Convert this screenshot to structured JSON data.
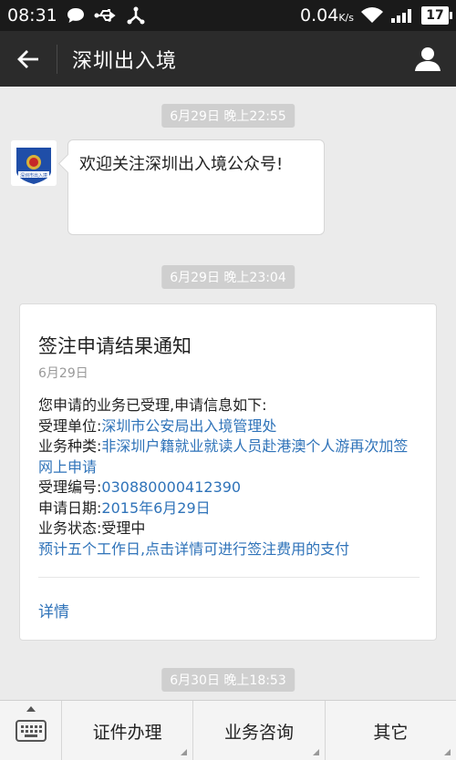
{
  "status_bar": {
    "time": "08:31",
    "net_speed": "0.04",
    "net_speed_unit": "K/s",
    "battery": "17"
  },
  "header": {
    "title": "深圳出入境"
  },
  "messages": [
    {
      "timestamp": "6月29日 晚上22:55",
      "text": "欢迎关注深圳出入境公众号!"
    },
    {
      "timestamp": "6月29日 晚上23:04"
    },
    {
      "timestamp": "6月30日 晚上18:53"
    }
  ],
  "card": {
    "title": "签注申请结果通知",
    "date": "6月29日",
    "intro": "您申请的业务已受理,申请信息如下:",
    "fields": [
      {
        "label": "受理单位:",
        "value": "深圳市公安局出入境管理处"
      },
      {
        "label": "业务种类:",
        "value": "非深圳户籍就业就读人员赴港澳个人游再次加签网上申请"
      },
      {
        "label": "受理编号:",
        "value": "030880000412390"
      },
      {
        "label": "申请日期:",
        "value": "2015年6月29日"
      },
      {
        "label": "业务状态:",
        "value": "受理中"
      }
    ],
    "note": "预计五个工作日,点击详情可进行签注费用的支付",
    "detail_link": "详情"
  },
  "bottom_menu": [
    "证件办理",
    "业务咨询",
    "其它"
  ],
  "avatar_text": "深圳市出入境",
  "colors": {
    "link": "#2f73b9",
    "header_bg": "#2b2b2b",
    "status_bg": "#1a1a1a"
  }
}
